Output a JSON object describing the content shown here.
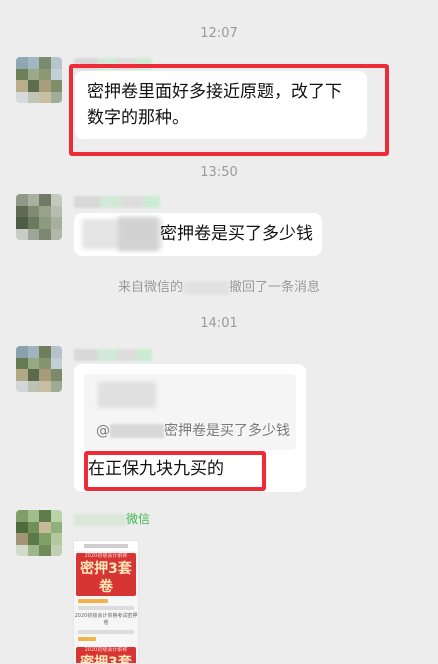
{
  "timestamps": [
    "12:07",
    "13:50",
    "14:01"
  ],
  "messages": {
    "m1": {
      "text": "密押卷里面好多接近原题，改了下数字的那种。"
    },
    "m2": {
      "text": "密押卷是买了多少钱"
    },
    "system_left": "来自微信的",
    "system_right": "撤回了一条消息",
    "m3": {
      "quote_text": "@",
      "quote_tail": "密押卷是买了多少钱",
      "reply_text": "在正保九块九买的"
    },
    "m4": {
      "name_suffix": "微信",
      "poster": {
        "header": "2020初级会计职称",
        "title": "密押3套卷",
        "title_2": "密押3套卷",
        "subtitle": "2020初级会计资格考试密押卷"
      }
    }
  },
  "colors": {
    "background": "#ededed",
    "bubble": "#ffffff",
    "highlight": "#ee2b36",
    "timestamp": "#9a9a9a",
    "poster_red": "#d73434"
  }
}
